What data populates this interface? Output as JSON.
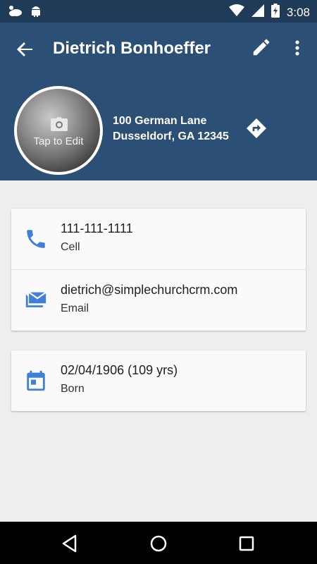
{
  "status_bar": {
    "time": "3:08",
    "icons": [
      "weather-icon",
      "android-icon",
      "wifi-icon",
      "signal-icon",
      "battery-charging-icon"
    ]
  },
  "header": {
    "title": "Dietrich Bonhoeffer",
    "background_color": "#2c5075",
    "avatar_overlay_text": "Tap to Edit",
    "address_line1": "100 German Lane",
    "address_line2": "Dusseldorf, GA 12345"
  },
  "contact_card": {
    "items": [
      {
        "value": "111-111-1111",
        "label": "Cell",
        "icon": "phone-icon"
      },
      {
        "value": "dietrich@simplechurchcrm.com",
        "label": "Email",
        "icon": "email-icon"
      }
    ]
  },
  "details_card": {
    "items": [
      {
        "value": "02/04/1906 (109 yrs)",
        "label": "Born",
        "icon": "calendar-icon"
      }
    ]
  },
  "colors": {
    "accent": "#3f7fd8",
    "status_bar": "#1f3b58",
    "app_bar": "#2c5075"
  }
}
